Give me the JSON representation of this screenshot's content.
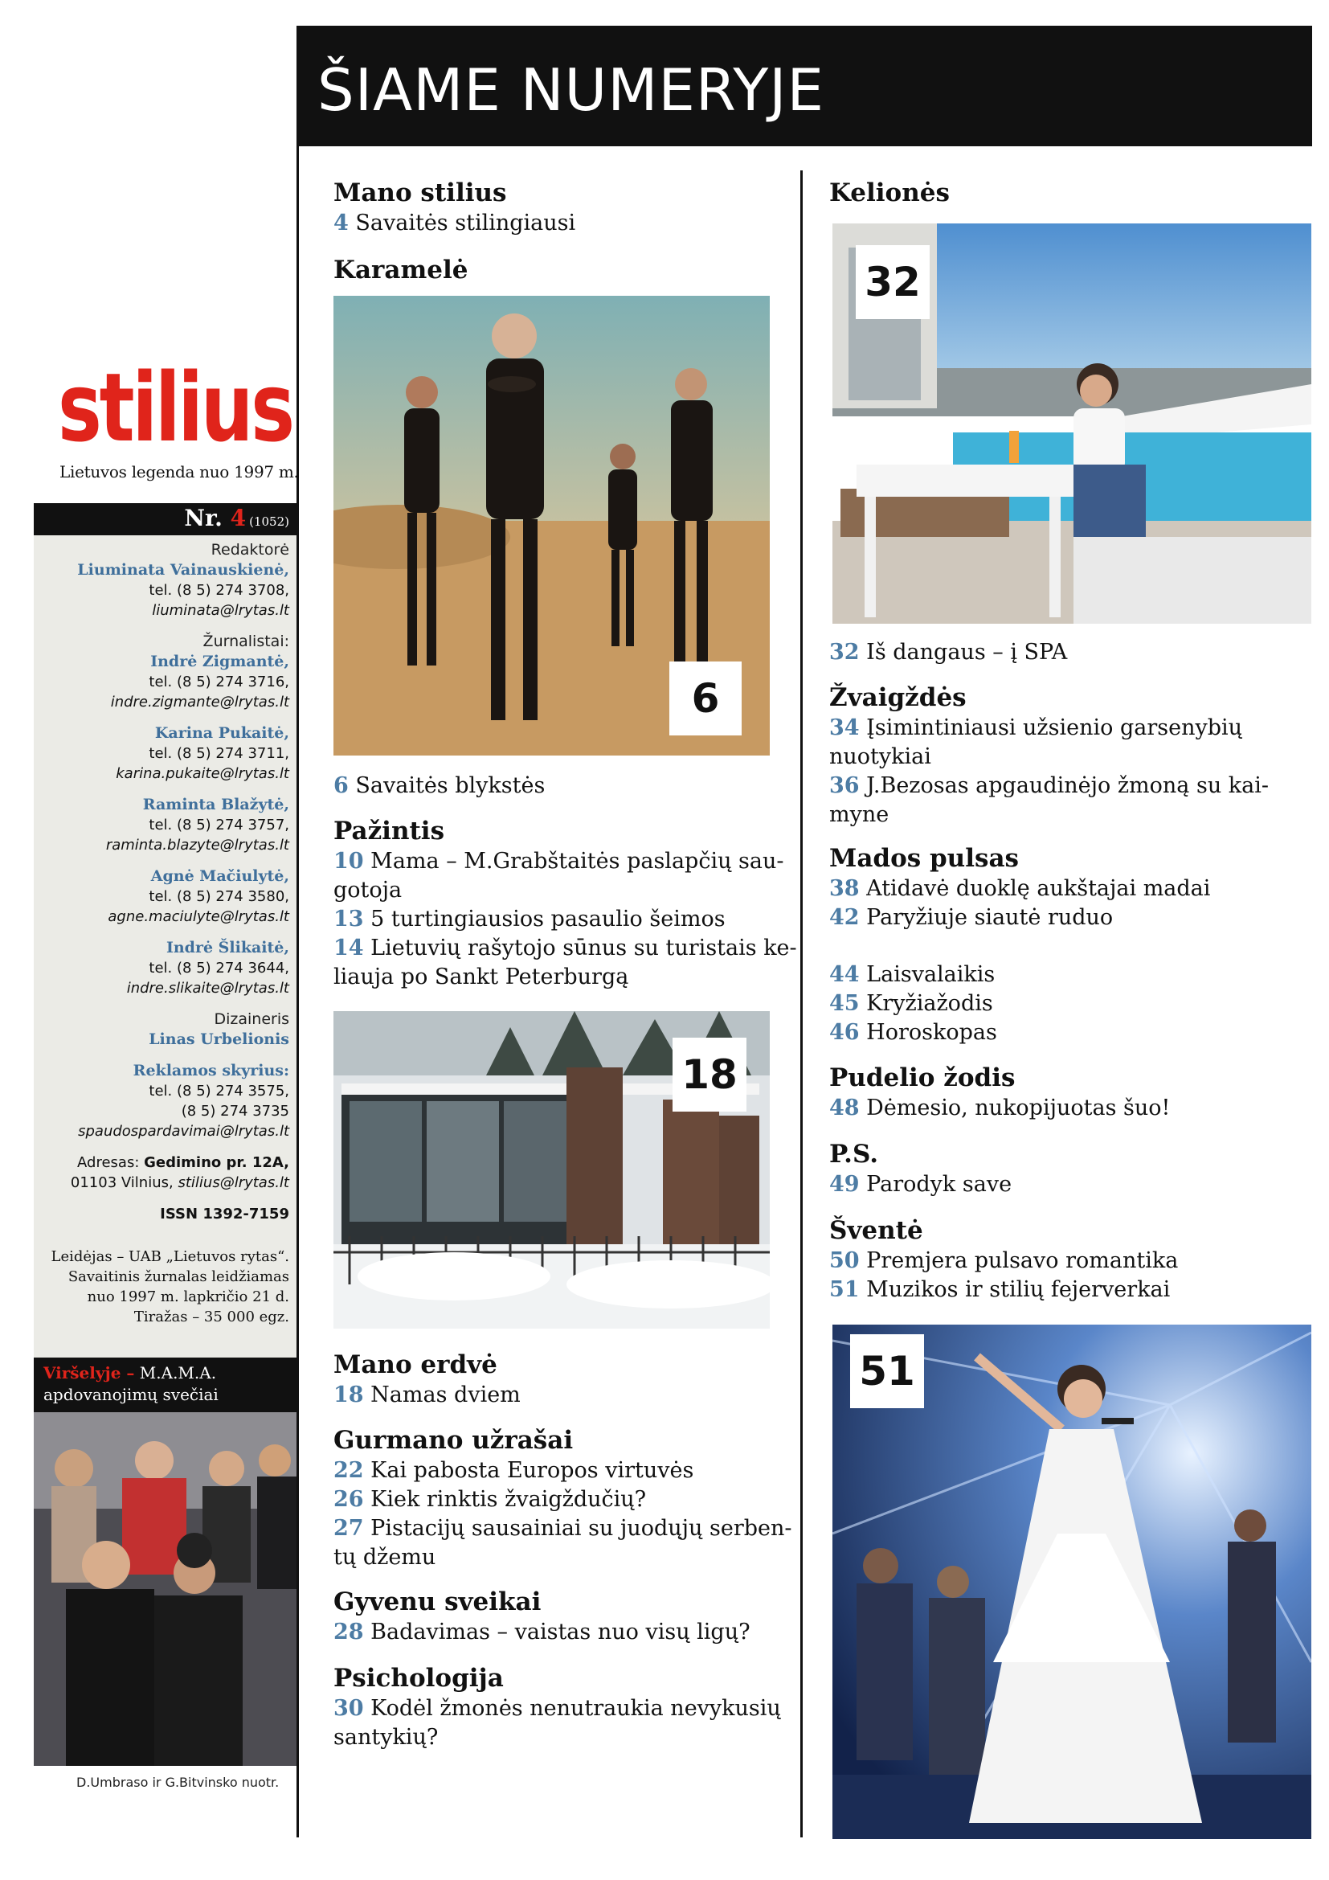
{
  "magazine": {
    "logo": "stilius",
    "tagline": "Lietuvos legenda nuo 1997 m.",
    "issue_label": "Nr.",
    "issue_number": "4",
    "issue_total": "(1052)"
  },
  "staff": {
    "editor_role": "Redaktorė",
    "editor_name": "Liuminata Vainauskienė,",
    "editor_tel": "tel. (8 5) 274 3708,",
    "editor_mail": "liuminata@lrytas.lt",
    "journalists_role": "Žurnalistai:",
    "j1_name": "Indrė Zigmantė,",
    "j1_tel": "tel. (8 5) 274 3716,",
    "j1_mail": "indre.zigmante@lrytas.lt",
    "j2_name": "Karina Pukaitė,",
    "j2_tel": "tel. (8 5) 274 3711,",
    "j2_mail": "karina.pukaite@lrytas.lt",
    "j3_name": "Raminta Blažytė,",
    "j3_tel": "tel. (8 5) 274 3757,",
    "j3_mail": "raminta.blazyte@lrytas.lt",
    "j4_name": "Agnė Mačiulytė,",
    "j4_tel": "tel. (8 5) 274 3580,",
    "j4_mail": "agne.maciulyte@lrytas.lt",
    "j5_name": "Indrė Šlikaitė,",
    "j5_tel": "tel. (8 5) 274 3644,",
    "j5_mail": "indre.slikaite@lrytas.lt",
    "designer_role": "Dizaineris",
    "designer_name": "Linas Urbelionis",
    "ads_role": "Reklamos skyrius:",
    "ads_tel1": "tel. (8 5) 274 3575,",
    "ads_tel2": "(8 5) 274 3735",
    "ads_mail": "spaudospardavimai@lrytas.lt",
    "address_label": "Adresas:",
    "address_street": "Gedimino pr. 12A,",
    "address_city": "01103 Vilnius,",
    "address_mail": "stilius@lrytas.lt",
    "issn": "ISSN 1392-7159",
    "publisher_1": "Leidėjas – UAB „Lietuvos rytas“.",
    "publisher_2": "Savaitinis žurnalas leidžiamas",
    "publisher_3": "nuo 1997 m. lapkričio 21 d.",
    "publisher_4": "Tiražas – 35 000 egz."
  },
  "cover": {
    "label": "Viršelyje –",
    "title_1": "M.A.M.A.",
    "title_2": "apdovanojimų svečiai",
    "credit": "D.Umbraso ir G.Bitvinsko nuotr."
  },
  "header": {
    "title": "ŠIAME NUMERYJE"
  },
  "left_column": {
    "mano_stilius": {
      "title": "Mano stilius",
      "items": [
        {
          "page": "4",
          "text": "Savaitės stilingiausi"
        }
      ]
    },
    "karamele": {
      "title": "Karamelė",
      "photo_badge": "6",
      "items": [
        {
          "page": "6",
          "text": "Savaitės blykstės"
        }
      ]
    },
    "pazintis": {
      "title": "Pažintis",
      "items": [
        {
          "page": "10",
          "text": "Mama – M.Grabštaitės paslapčių sau-"
        },
        {
          "page": "",
          "text": "gotoja"
        },
        {
          "page": "13",
          "text": "5 turtingiausios pasaulio šeimos"
        },
        {
          "page": "14",
          "text": "Lietuvių rašytojo sūnus su turistais ke-"
        },
        {
          "page": "",
          "text": "liauja po Sankt Peterburgą"
        }
      ]
    },
    "house_photo_badge": "18",
    "mano_erdve": {
      "title": "Mano erdvė",
      "items": [
        {
          "page": "18",
          "text": "Namas dviem"
        }
      ]
    },
    "gurmano": {
      "title": "Gurmano užrašai",
      "items": [
        {
          "page": "22",
          "text": "Kai pabosta Europos virtuvės"
        },
        {
          "page": "26",
          "text": "Kiek rinktis žvaigždučių?"
        },
        {
          "page": "27",
          "text": "Pistacijų sausainiai su juodųjų serben-"
        },
        {
          "page": "",
          "text": "tų džemu"
        }
      ]
    },
    "gyvenu": {
      "title": "Gyvenu sveikai",
      "items": [
        {
          "page": "28",
          "text": "Badavimas – vaistas nuo visų ligų?"
        }
      ]
    },
    "psichologija": {
      "title": "Psichologija",
      "items": [
        {
          "page": "30",
          "text": "Kodėl žmonės nenutraukia nevykusių"
        },
        {
          "page": "",
          "text": "santykių?"
        }
      ]
    }
  },
  "right_column": {
    "keliones": {
      "title": "Kelionės",
      "photo_badge": "32",
      "items": [
        {
          "page": "32",
          "text": "Iš dangaus – į SPA"
        }
      ]
    },
    "zvaigzdes": {
      "title": "Žvaigždės",
      "items": [
        {
          "page": "34",
          "text": "Įsimintiniausi užsienio garsenybių"
        },
        {
          "page": "",
          "text": "nuotykiai"
        },
        {
          "page": "36",
          "text": "J.Bezosas apgaudinėjo žmoną su kai-"
        },
        {
          "page": "",
          "text": "myne"
        }
      ]
    },
    "mados": {
      "title": "Mados pulsas",
      "items": [
        {
          "page": "38",
          "text": "Atidavė duoklę aukštajai madai"
        },
        {
          "page": "42",
          "text": "Paryžiuje siautė ruduo"
        }
      ]
    },
    "misc": {
      "items": [
        {
          "page": "44",
          "text": "Laisvalaikis"
        },
        {
          "page": "45",
          "text": "Kryžiažodis"
        },
        {
          "page": "46",
          "text": "Horoskopas"
        }
      ]
    },
    "pudelio": {
      "title": "Pudelio žodis",
      "items": [
        {
          "page": "48",
          "text": "Dėmesio, nukopijuotas šuo!"
        }
      ]
    },
    "ps": {
      "title": "P.S.",
      "items": [
        {
          "page": "49",
          "text": "Parodyk save"
        }
      ]
    },
    "svente": {
      "title": "Šventė",
      "photo_badge": "51",
      "items": [
        {
          "page": "50",
          "text": "Premjera pulsavo romantika"
        },
        {
          "page": "51",
          "text": "Muzikos ir stilių fejerverkai"
        }
      ]
    }
  },
  "colors": {
    "accent_red": "#e0241b",
    "page_blue": "#4d7ca4",
    "name_blue": "#3f6f9b"
  }
}
